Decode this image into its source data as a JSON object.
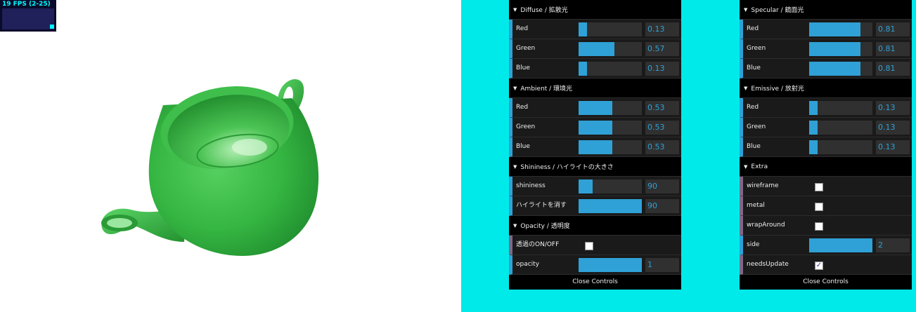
{
  "fps": {
    "text": "19 FPS (2-25)"
  },
  "teapot_color": "#3cb648",
  "left_panel": {
    "folders": [
      {
        "title": "Diffuse / 拡散光",
        "controls": [
          {
            "label": "Red",
            "value": "0.13",
            "fill": 0.13
          },
          {
            "label": "Green",
            "value": "0.57",
            "fill": 0.57
          },
          {
            "label": "Blue",
            "value": "0.13",
            "fill": 0.13
          }
        ]
      },
      {
        "title": "Ambient / 環境光",
        "controls": [
          {
            "label": "Red",
            "value": "0.53",
            "fill": 0.53
          },
          {
            "label": "Green",
            "value": "0.53",
            "fill": 0.53
          },
          {
            "label": "Blue",
            "value": "0.53",
            "fill": 0.53
          }
        ]
      },
      {
        "title": "Shininess / ハイライトの大きさ",
        "controls": [
          {
            "label": "shininess",
            "value": "90",
            "fill": 0.225
          },
          {
            "label": "ハイライトを消す",
            "value": "90",
            "fill": 1.0
          }
        ]
      },
      {
        "title": "Opacity / 透明度",
        "checkbox": {
          "label": "透過のON/OFF",
          "checked": false
        },
        "controls": [
          {
            "label": "opacity",
            "value": "1",
            "fill": 1.0
          }
        ]
      }
    ],
    "close_label": "Close Controls"
  },
  "right_panel": {
    "folders": [
      {
        "title": "Specular / 鏡面光",
        "controls": [
          {
            "label": "Red",
            "value": "0.81",
            "fill": 0.81
          },
          {
            "label": "Green",
            "value": "0.81",
            "fill": 0.81
          },
          {
            "label": "Blue",
            "value": "0.81",
            "fill": 0.81
          }
        ]
      },
      {
        "title": "Emissive / 放射光",
        "controls": [
          {
            "label": "Red",
            "value": "0.13",
            "fill": 0.13
          },
          {
            "label": "Green",
            "value": "0.13",
            "fill": 0.13
          },
          {
            "label": "Blue",
            "value": "0.13",
            "fill": 0.13
          }
        ]
      },
      {
        "title": "Extra",
        "checkboxes": [
          {
            "label": "wireframe",
            "checked": false
          },
          {
            "label": "metal",
            "checked": false
          },
          {
            "label": "wrapAround",
            "checked": false
          }
        ],
        "side": {
          "label": "side",
          "value": "2",
          "fill": 1.0
        },
        "needs_update": {
          "label": "needsUpdate",
          "checked": true
        }
      }
    ],
    "close_label": "Close Controls"
  }
}
